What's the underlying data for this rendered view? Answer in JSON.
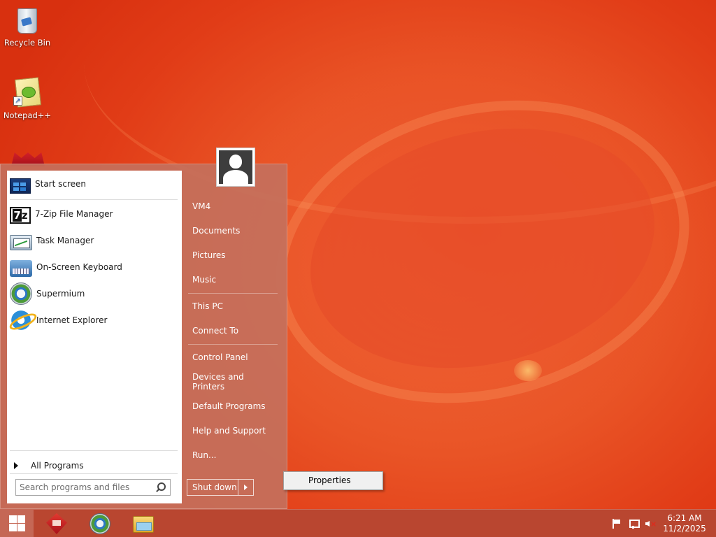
{
  "desktop": {
    "icons": [
      {
        "label": "Recycle Bin",
        "icon": "recycle-bin-icon"
      },
      {
        "label": "Notepad++",
        "icon": "notepad-plus-plus-icon"
      }
    ]
  },
  "start_menu": {
    "pinned": [
      {
        "label": "Start screen",
        "icon": "start-screen-icon"
      },
      {
        "label": "7-Zip File Manager",
        "icon": "7zip-icon"
      },
      {
        "label": "Task Manager",
        "icon": "task-manager-icon"
      },
      {
        "label": "On-Screen Keyboard",
        "icon": "keyboard-icon"
      },
      {
        "label": "Supermium",
        "icon": "supermium-icon"
      },
      {
        "label": "Internet Explorer",
        "icon": "internet-explorer-icon"
      }
    ],
    "all_programs": "All Programs",
    "search_placeholder": "Search programs and files",
    "right": {
      "user": "VM4",
      "documents": "Documents",
      "pictures": "Pictures",
      "music": "Music",
      "this_pc": "This PC",
      "connect_to": "Connect To",
      "control_panel": "Control Panel",
      "devices_printers": "Devices and Printers",
      "default_programs": "Default Programs",
      "help_support": "Help and Support",
      "run": "Run..."
    },
    "shutdown_label": "Shut down"
  },
  "context_menu": {
    "properties": "Properties"
  },
  "taskbar": {
    "apps": [
      "red-app-icon",
      "supermium-icon",
      "file-explorer-icon"
    ],
    "tray_icons": [
      "flag-icon",
      "network-icon",
      "volume-muted-icon"
    ],
    "clock": {
      "time": "6:21 AM",
      "date": "11/2/2025"
    }
  },
  "colors": {
    "wallpaper": "#e8431b",
    "start_menu_bg": "#c4705c",
    "taskbar_bg": "#b44632"
  }
}
